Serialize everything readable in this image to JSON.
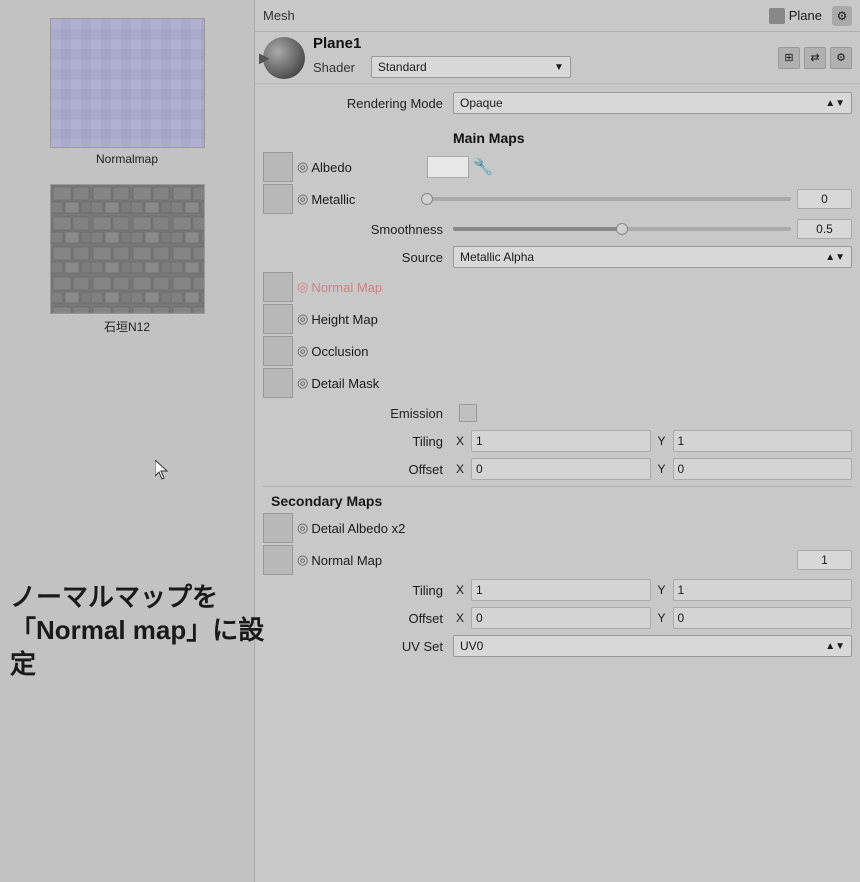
{
  "leftPanel": {
    "asset1": {
      "label": "Normalmap"
    },
    "asset2": {
      "label": "石垣N12"
    }
  },
  "annotation": {
    "line1": "ノーマルマップを",
    "line2": "「Normal map」に設定"
  },
  "topBar": {
    "meshLabel": "Mesh",
    "meshValue": "Plane",
    "gearLabel": "⚙"
  },
  "planeHeader": {
    "name": "Plane1",
    "shaderLabel": "Shader",
    "shaderValue": "Standard"
  },
  "properties": {
    "renderingModeLabel": "Rendering Mode",
    "renderingModeValue": "Opaque",
    "mainMapsLabel": "Main Maps",
    "albedoLabel": "Albedo",
    "metallicLabel": "Metallic",
    "metallicValue": "0",
    "metallicSliderPercent": 0,
    "smoothnessLabel": "Smoothness",
    "smoothnessValue": "0.5",
    "smoothnessSliderPercent": 50,
    "sourceLabel": "Source",
    "sourceValue": "Metallic Alpha",
    "normalMapLabel": "Normal Map",
    "heightMapLabel": "Height Map",
    "occlusionLabel": "Occlusion",
    "detailMaskLabel": "Detail Mask",
    "emissionLabel": "Emission",
    "tilingLabel": "Tiling",
    "tilingX": "1",
    "tilingY": "1",
    "offsetLabel": "Offset",
    "offsetX": "0",
    "offsetY": "0",
    "secondaryMapsLabel": "Secondary Maps",
    "detailAlbedoLabel": "Detail Albedo x2",
    "secNormalMapLabel": "Normal Map",
    "secNormalValue": "1",
    "secTilingLabel": "Tiling",
    "secTilingX": "1",
    "secTilingY": "1",
    "secOffsetLabel": "Offset",
    "secOffsetX": "0",
    "secOffsetY": "0",
    "uvSetLabel": "UV Set",
    "uvSetValue": "UV0"
  }
}
